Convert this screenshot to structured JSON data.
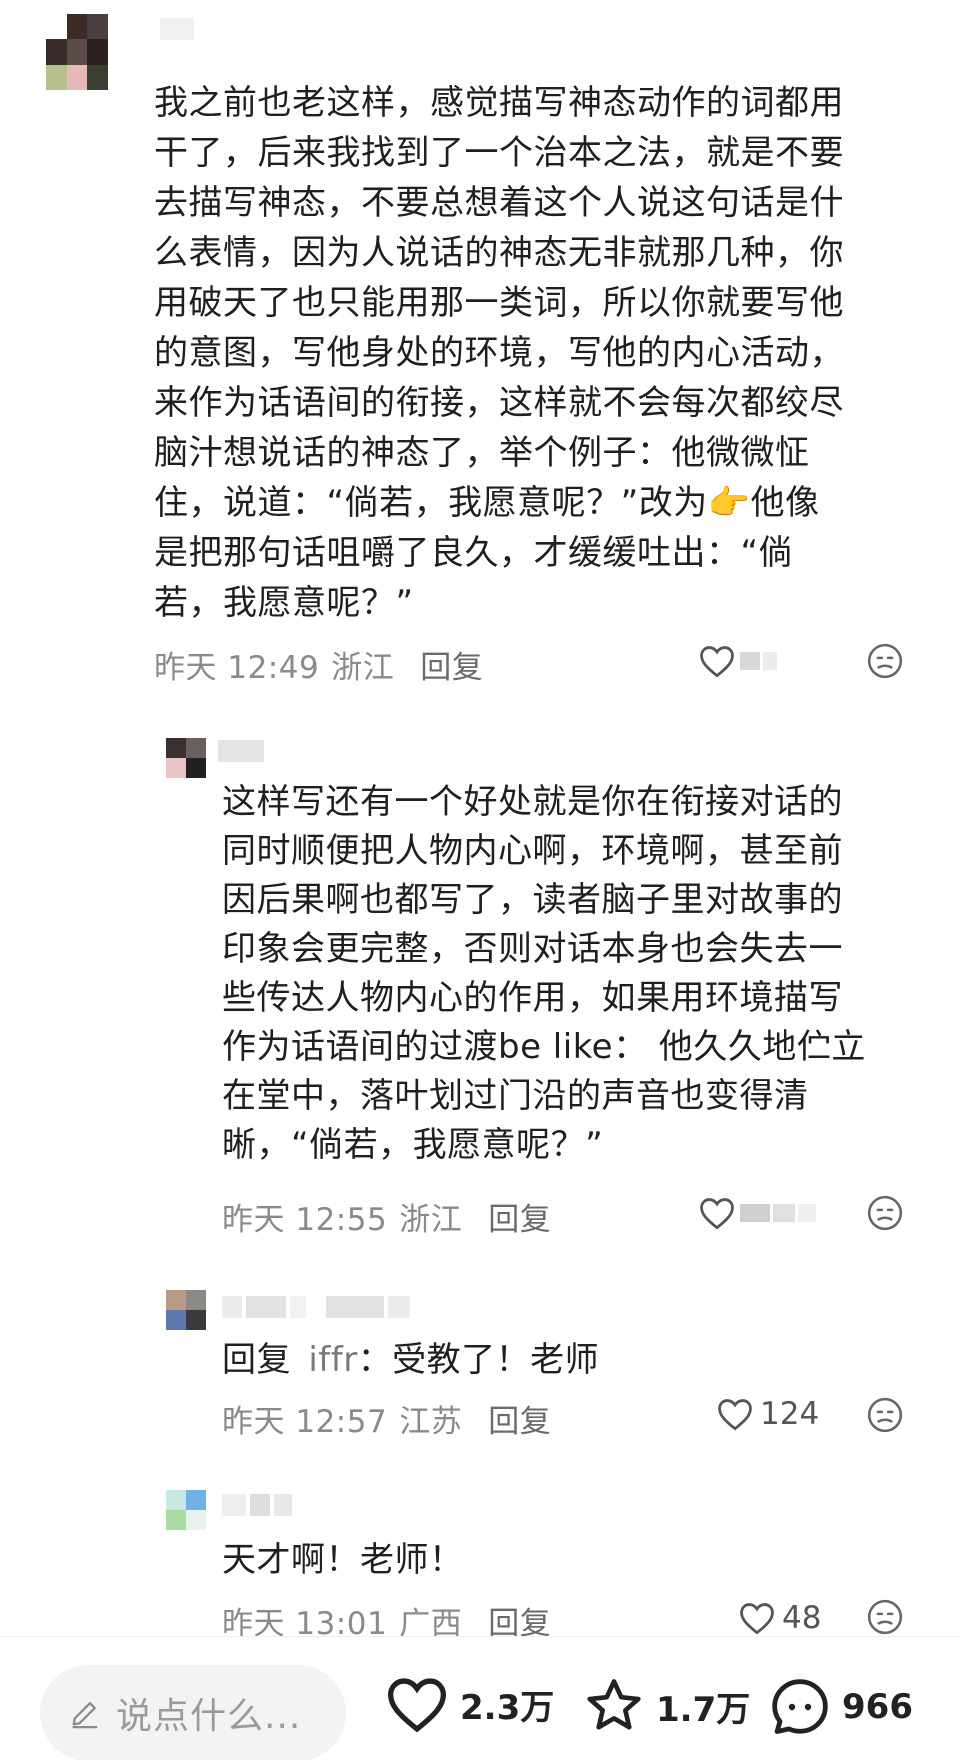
{
  "comments": [
    {
      "text_lines": [
        "我之前也老这样，感觉描写神态动作的词都用",
        "干了，后来我找到了一个治本之法，就是不要",
        "去描写神态，不要总想着这个人说这句话是什",
        "么表情，因为人说话的神态无非就那几种，你",
        "用破天了也只能用那一类词，所以你就要写他",
        "的意图，写他身处的环境，写他的内心活动，",
        "来作为话语间的衔接，这样就不会每次都绞尽",
        "脑汁想说话的神态了，举个例子：他微微怔",
        "住，说道：“倘若，我愿意呢？”改为",
        "是把那句话咀嚼了良久，才缓缓吐出：“倘",
        "若，我愿意呢？”"
      ],
      "line9_suffix": "他像",
      "emoji": "👉",
      "time": "昨天 12:49",
      "location": "浙江",
      "reply_label": "回复",
      "like_icon": "heart-outline-icon",
      "dislike_icon": "frown-face-icon"
    },
    {
      "text_lines": [
        "这样写还有一个好处就是你在衔接对话的",
        "同时顺便把人物内心啊，环境啊，甚至前",
        "因后果啊也都写了，读者脑子里对故事的",
        "印象会更完整，否则对话本身也会失去一",
        "些传达人物内心的作用，如果用环境描写",
        "作为话语间的过渡be like： 他久久地伫立",
        "在堂中，落叶划过门沿的声音也变得清",
        "晰，“倘若，我愿意呢？”"
      ],
      "time": "昨天 12:55",
      "location": "浙江",
      "reply_label": "回复"
    },
    {
      "prefix": "回复",
      "mention": "iffr",
      "body": "：受教了！老师",
      "time": "昨天 12:57",
      "location": "江苏",
      "reply_label": "回复",
      "likes": "124"
    },
    {
      "text": "天才啊！老师！",
      "time": "昨天 13:01",
      "location": "广西",
      "reply_label": "回复",
      "likes": "48"
    }
  ],
  "bottom_bar": {
    "input_placeholder": "说点什么...",
    "likes": "2.3万",
    "favorites": "1.7万",
    "comments": "966"
  },
  "colors": {
    "text": "#1f1f1f",
    "meta": "#8a8a8a",
    "emoji": "#f0a020"
  }
}
